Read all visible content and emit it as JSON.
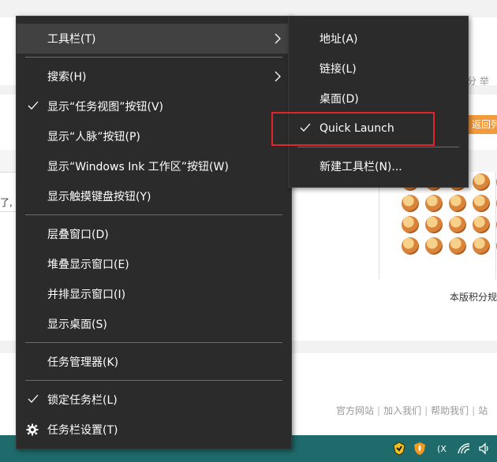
{
  "background_page": {
    "right_fragment": "分 举",
    "return_button": "返回列",
    "left_fragment": "了,",
    "credit_text": "本版积分规",
    "footer_links": [
      "官方网站",
      "加入我们",
      "帮助我们",
      "站"
    ],
    "footer_sep": "|"
  },
  "context_menu": {
    "items": [
      {
        "label": "工具栏(T)",
        "has_submenu": true,
        "checked": false
      },
      {
        "label": "搜索(H)",
        "has_submenu": true,
        "checked": false
      },
      {
        "label": "显示“任务视图”按钮(V)",
        "has_submenu": false,
        "checked": true
      },
      {
        "label": "显示“人脉”按钮(P)",
        "has_submenu": false,
        "checked": false
      },
      {
        "label": "显示“Windows Ink 工作区”按钮(W)",
        "has_submenu": false,
        "checked": false
      },
      {
        "label": "显示触摸键盘按钮(Y)",
        "has_submenu": false,
        "checked": false
      },
      {
        "label": "层叠窗口(D)",
        "has_submenu": false,
        "checked": false
      },
      {
        "label": "堆叠显示窗口(E)",
        "has_submenu": false,
        "checked": false
      },
      {
        "label": "并排显示窗口(I)",
        "has_submenu": false,
        "checked": false
      },
      {
        "label": "显示桌面(S)",
        "has_submenu": false,
        "checked": false
      },
      {
        "label": "任务管理器(K)",
        "has_submenu": false,
        "checked": false
      },
      {
        "label": "锁定任务栏(L)",
        "has_submenu": false,
        "checked": true
      },
      {
        "label": "任务栏设置(T)",
        "has_submenu": false,
        "checked": false,
        "icon": "gear-icon"
      }
    ]
  },
  "toolbar_submenu": {
    "items": [
      {
        "label": "地址(A)",
        "checked": false
      },
      {
        "label": "链接(L)",
        "checked": false
      },
      {
        "label": "桌面(D)",
        "checked": false
      },
      {
        "label": "Quick Launch",
        "checked": true
      },
      {
        "label": "新建工具栏(N)...",
        "checked": false
      }
    ]
  },
  "tray": {
    "icons": [
      "shield-app-icon",
      "security-shield-icon",
      "ime-icon",
      "wifi-icon",
      "volume-icon"
    ],
    "ime_label": "(X"
  },
  "colors": {
    "menu_bg": "#2b2b2b",
    "menu_hover": "#414141",
    "highlight_box": "#e0262b",
    "taskbar": "#1f6b6b"
  }
}
